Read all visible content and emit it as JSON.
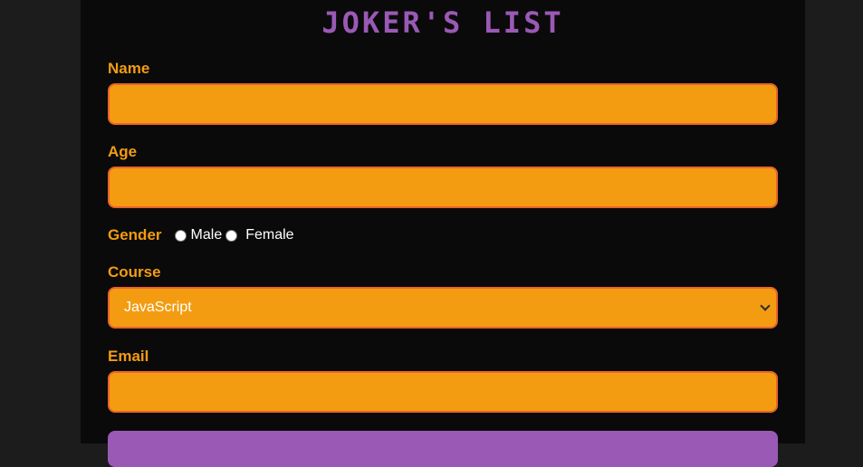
{
  "title": "JOKER'S LIST",
  "form": {
    "name_label": "Name",
    "name_value": "",
    "age_label": "Age",
    "age_value": "",
    "gender_label": "Gender",
    "gender_options": [
      "Male",
      "Female"
    ],
    "course_label": "Course",
    "course_selected": "JavaScript",
    "email_label": "Email",
    "email_value": "",
    "submit_label": ""
  },
  "colors": {
    "background": "#1c1c1c",
    "panel": "#0a0a0a",
    "accent_orange": "#f39c12",
    "border_orange": "#e8632a",
    "accent_purple": "#9b59b6"
  }
}
